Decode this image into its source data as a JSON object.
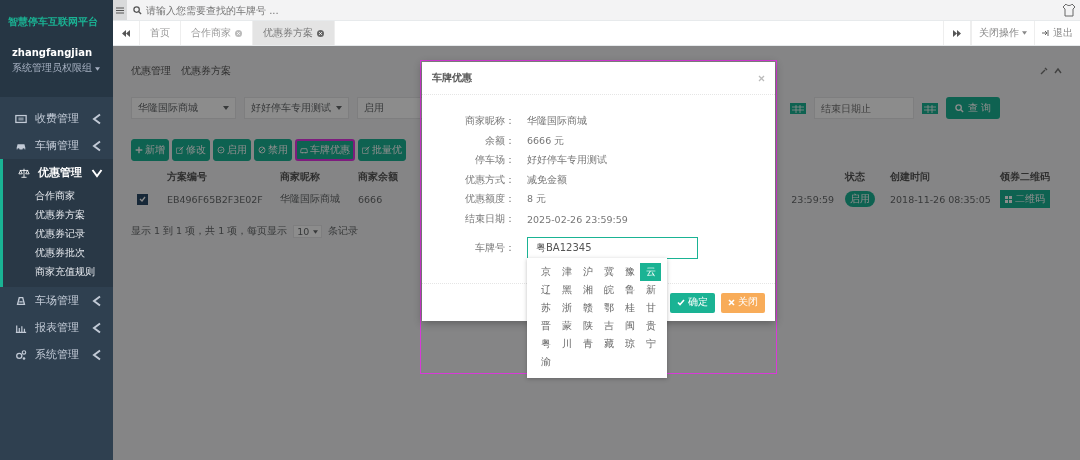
{
  "sidebar": {
    "brand": "智慧停车互联网平台",
    "user": "zhangfangjian",
    "role": "系统管理员权限组",
    "menu": [
      {
        "label": "收费管理",
        "expanded": false
      },
      {
        "label": "车辆管理",
        "expanded": false
      },
      {
        "label": "优惠管理",
        "expanded": true,
        "children": [
          {
            "label": "合作商家"
          },
          {
            "label": "优惠券方案"
          },
          {
            "label": "优惠券记录"
          },
          {
            "label": "优惠券批次"
          },
          {
            "label": "商家充值规则"
          }
        ]
      },
      {
        "label": "车场管理",
        "expanded": false
      },
      {
        "label": "报表管理",
        "expanded": false
      },
      {
        "label": "系统管理",
        "expanded": false
      }
    ]
  },
  "search": {
    "placeholder": "请输入您需要查找的车牌号 ..."
  },
  "tabs": [
    {
      "label": "首页",
      "closable": false,
      "selected": false
    },
    {
      "label": "合作商家",
      "closable": true,
      "selected": false
    },
    {
      "label": "优惠券方案",
      "closable": true,
      "selected": true
    }
  ],
  "tab_actions": {
    "close_menu": "关闭操作",
    "logout": "退出"
  },
  "breadcrumb": [
    "优惠管理",
    "优惠券方案"
  ],
  "filters": [
    {
      "value": "华隆国际商城"
    },
    {
      "value": "好好停车专用测试"
    },
    {
      "value": "启用"
    }
  ],
  "end_date": {
    "placeholder": "结束日期止"
  },
  "query_button": "查 询",
  "toolbar": [
    {
      "label": "新增",
      "highlighted": false
    },
    {
      "label": "修改",
      "highlighted": false
    },
    {
      "label": "启用",
      "highlighted": false
    },
    {
      "label": "禁用",
      "highlighted": false
    },
    {
      "label": "车牌优惠",
      "highlighted": true
    },
    {
      "label": "批量优",
      "highlighted": false
    }
  ],
  "table": {
    "columns": [
      "方案编号",
      "商家昵称",
      "商家余额",
      "状态",
      "创建时间",
      "领券二维码"
    ],
    "rows": [
      {
        "selected": true,
        "scheme_no": "EB496F65B2F3E02F",
        "merchant": "华隆国际商城",
        "balance": "6666",
        "end_time": "23:59:59",
        "status": "启用",
        "created": "2018-11-26 08:35:05",
        "qr_button": "二维码"
      }
    ]
  },
  "pagination": {
    "summary": "显示 1 到 1 项，共 1 项，每页显示",
    "page_size": "10",
    "suffix": "条记录"
  },
  "modal": {
    "title": "车牌优惠",
    "highlighted": true,
    "fields": [
      {
        "label": "商家昵称：",
        "value": "华隆国际商城"
      },
      {
        "label": "余额：",
        "value": "6666 元"
      },
      {
        "label": "停车场：",
        "value": "好好停车专用测试"
      },
      {
        "label": "优惠方式：",
        "value": "减免金额"
      },
      {
        "label": "优惠额度：",
        "value": "8 元"
      },
      {
        "label": "结束日期：",
        "value": "2025-02-26 23:59:59"
      }
    ],
    "plate_label": "车牌号：",
    "plate_value": "粤BA12345",
    "keyboard": [
      {
        "key": "京",
        "selected": false
      },
      {
        "key": "津",
        "selected": false
      },
      {
        "key": "沪",
        "selected": false
      },
      {
        "key": "冀",
        "selected": false
      },
      {
        "key": "豫",
        "selected": false
      },
      {
        "key": "云",
        "selected": true
      },
      {
        "key": "辽",
        "selected": false
      },
      {
        "key": "黑",
        "selected": false
      },
      {
        "key": "湘",
        "selected": false
      },
      {
        "key": "皖",
        "selected": false
      },
      {
        "key": "鲁",
        "selected": false
      },
      {
        "key": "新",
        "selected": false
      },
      {
        "key": "苏",
        "selected": false
      },
      {
        "key": "浙",
        "selected": false
      },
      {
        "key": "赣",
        "selected": false
      },
      {
        "key": "鄂",
        "selected": false
      },
      {
        "key": "桂",
        "selected": false
      },
      {
        "key": "甘",
        "selected": false
      },
      {
        "key": "晋",
        "selected": false
      },
      {
        "key": "蒙",
        "selected": false
      },
      {
        "key": "陕",
        "selected": false
      },
      {
        "key": "吉",
        "selected": false
      },
      {
        "key": "闽",
        "selected": false
      },
      {
        "key": "贵",
        "selected": false
      },
      {
        "key": "粤",
        "selected": false
      },
      {
        "key": "川",
        "selected": false
      },
      {
        "key": "青",
        "selected": false
      },
      {
        "key": "藏",
        "selected": false
      },
      {
        "key": "琼",
        "selected": false
      },
      {
        "key": "宁",
        "selected": false
      },
      {
        "key": "渝",
        "selected": false
      }
    ],
    "confirm": "确定",
    "close": "关闭"
  }
}
